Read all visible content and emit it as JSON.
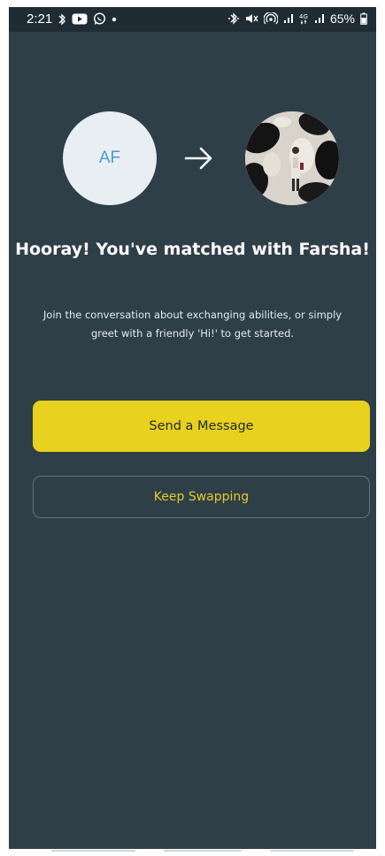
{
  "status_bar": {
    "time": "2:21",
    "battery": "65%",
    "icons": [
      "bluetooth-icon",
      "youtube-icon",
      "whatsapp-icon",
      "dot-icon",
      "bluetooth-icon",
      "mute-icon",
      "hotspot-icon",
      "signal-icon",
      "4g-icon",
      "signal-icon",
      "battery-icon"
    ]
  },
  "match": {
    "user_initials": "AF",
    "arrow_icon": "arrow-right-icon",
    "partner_photo_icon": "profile-photo"
  },
  "headline": "Hooray! You've matched with Farsha!",
  "description": "Join the conversation about exchanging abilities, or simply greet with a friendly 'Hi!' to get started.",
  "actions": {
    "primary_label": "Send a Message",
    "secondary_label": "Keep Swapping"
  },
  "colors": {
    "background": "#2f3f48",
    "accent": "#e8d11f",
    "avatar_bg": "#e8eef2",
    "initials": "#4a9ecb"
  }
}
